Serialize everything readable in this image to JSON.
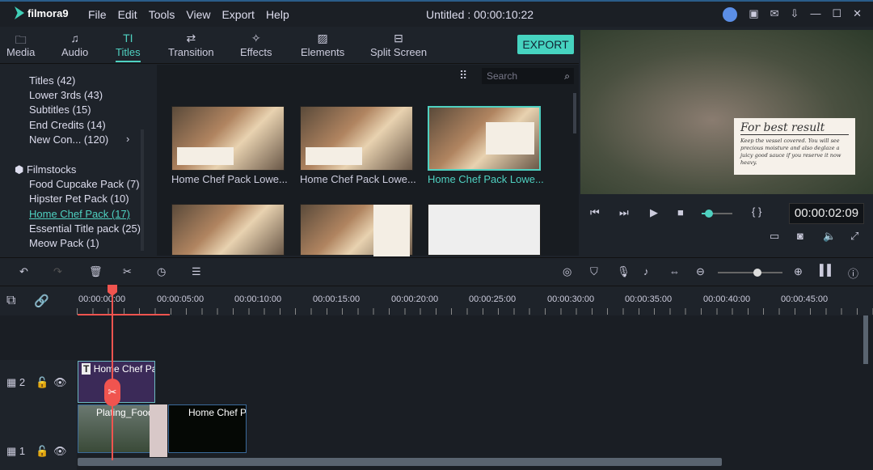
{
  "app": {
    "name": "filmora9",
    "title": "Untitled : 00:00:10:22"
  },
  "menu": [
    "File",
    "Edit",
    "Tools",
    "View",
    "Export",
    "Help"
  ],
  "tabs": [
    {
      "label": "Media",
      "icon": "folder-icon"
    },
    {
      "label": "Audio",
      "icon": "music-note-icon"
    },
    {
      "label": "Titles",
      "icon": "text-icon",
      "active": true
    },
    {
      "label": "Transition",
      "icon": "transition-icon"
    },
    {
      "label": "Effects",
      "icon": "effects-icon"
    },
    {
      "label": "Elements",
      "icon": "image-icon"
    },
    {
      "label": "Split Screen",
      "icon": "split-screen-icon"
    }
  ],
  "export_label": "EXPORT",
  "sidebar": {
    "items": [
      "Titles (42)",
      "Lower 3rds (43)",
      "Subtitles (15)",
      "End Credits (14)",
      "New Con... (120)"
    ],
    "group": "Filmstocks",
    "sub": [
      "Food Cupcake Pack (7)",
      "Hipster Pet Pack (10)",
      "Home Chef Pack (17)",
      "Essential Title pack (25)",
      "Meow Pack (1)"
    ],
    "selected": "Home Chef Pack (17)"
  },
  "search_placeholder": "Search",
  "thumbs": [
    "Home Chef Pack Lowe...",
    "Home Chef Pack Lowe...",
    "Home Chef Pack Lowe..."
  ],
  "preview": {
    "note_title": "For best result",
    "note_body": "Keep the vessel covered. You will see precious moisture and also deglaze a juicy good sauce if you reserve it now heavy.",
    "timecode": "00:00:02:09",
    "progress": 0.08
  },
  "ruler": [
    "00:00:00:00",
    "00:00:05:00",
    "00:00:10:00",
    "00:00:15:00",
    "00:00:20:00",
    "00:00:25:00",
    "00:00:30:00",
    "00:00:35:00",
    "00:00:40:00",
    "00:00:45:00"
  ],
  "tracks": [
    {
      "num": "2",
      "clips": [
        "Home Chef Pa"
      ]
    },
    {
      "num": "1",
      "clips": [
        "Plating_Food",
        "Home Chef Pa"
      ]
    }
  ],
  "accent": "#4fd1c1",
  "playhead_color": "#f0544f"
}
